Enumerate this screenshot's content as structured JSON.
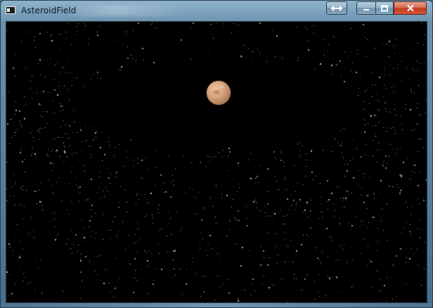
{
  "window": {
    "title": "AsteroidField",
    "frame_color": "#557c98",
    "close_color": "#c0381c"
  },
  "titlebar": {
    "app_icon": "console-window-icon",
    "buttons": [
      {
        "name": "resize-toggle",
        "icon": "double-arrow-icon"
      },
      {
        "name": "minimize",
        "icon": "minimize-icon"
      },
      {
        "name": "maximize",
        "icon": "maximize-icon"
      },
      {
        "name": "close",
        "icon": "close-icon"
      }
    ]
  },
  "scene": {
    "background": "#000000",
    "asteroid_color": "#c8916a",
    "planet_color": "#d9a780"
  }
}
